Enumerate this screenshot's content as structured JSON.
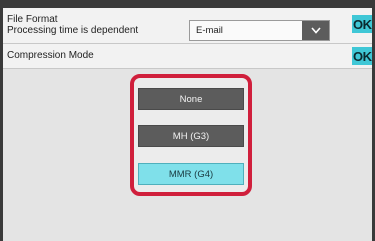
{
  "file_format": {
    "line1": "File Format",
    "line2": "Processing time is dependent",
    "selected_value": "E-mail",
    "ok_label": "OK"
  },
  "compression_mode": {
    "label": "Compression Mode",
    "ok_label": "OK",
    "options": [
      {
        "label": "None",
        "selected": false
      },
      {
        "label": "MH (G3)",
        "selected": false
      },
      {
        "label": "MMR (G4)",
        "selected": true
      }
    ]
  },
  "colors": {
    "accent": "#3fc7d6",
    "selected_option": "#7fe0ea",
    "highlight_frame": "#d01f3c",
    "button_dark": "#5c5c5c"
  },
  "icons": {
    "dropdown": "chevron-down-icon"
  }
}
